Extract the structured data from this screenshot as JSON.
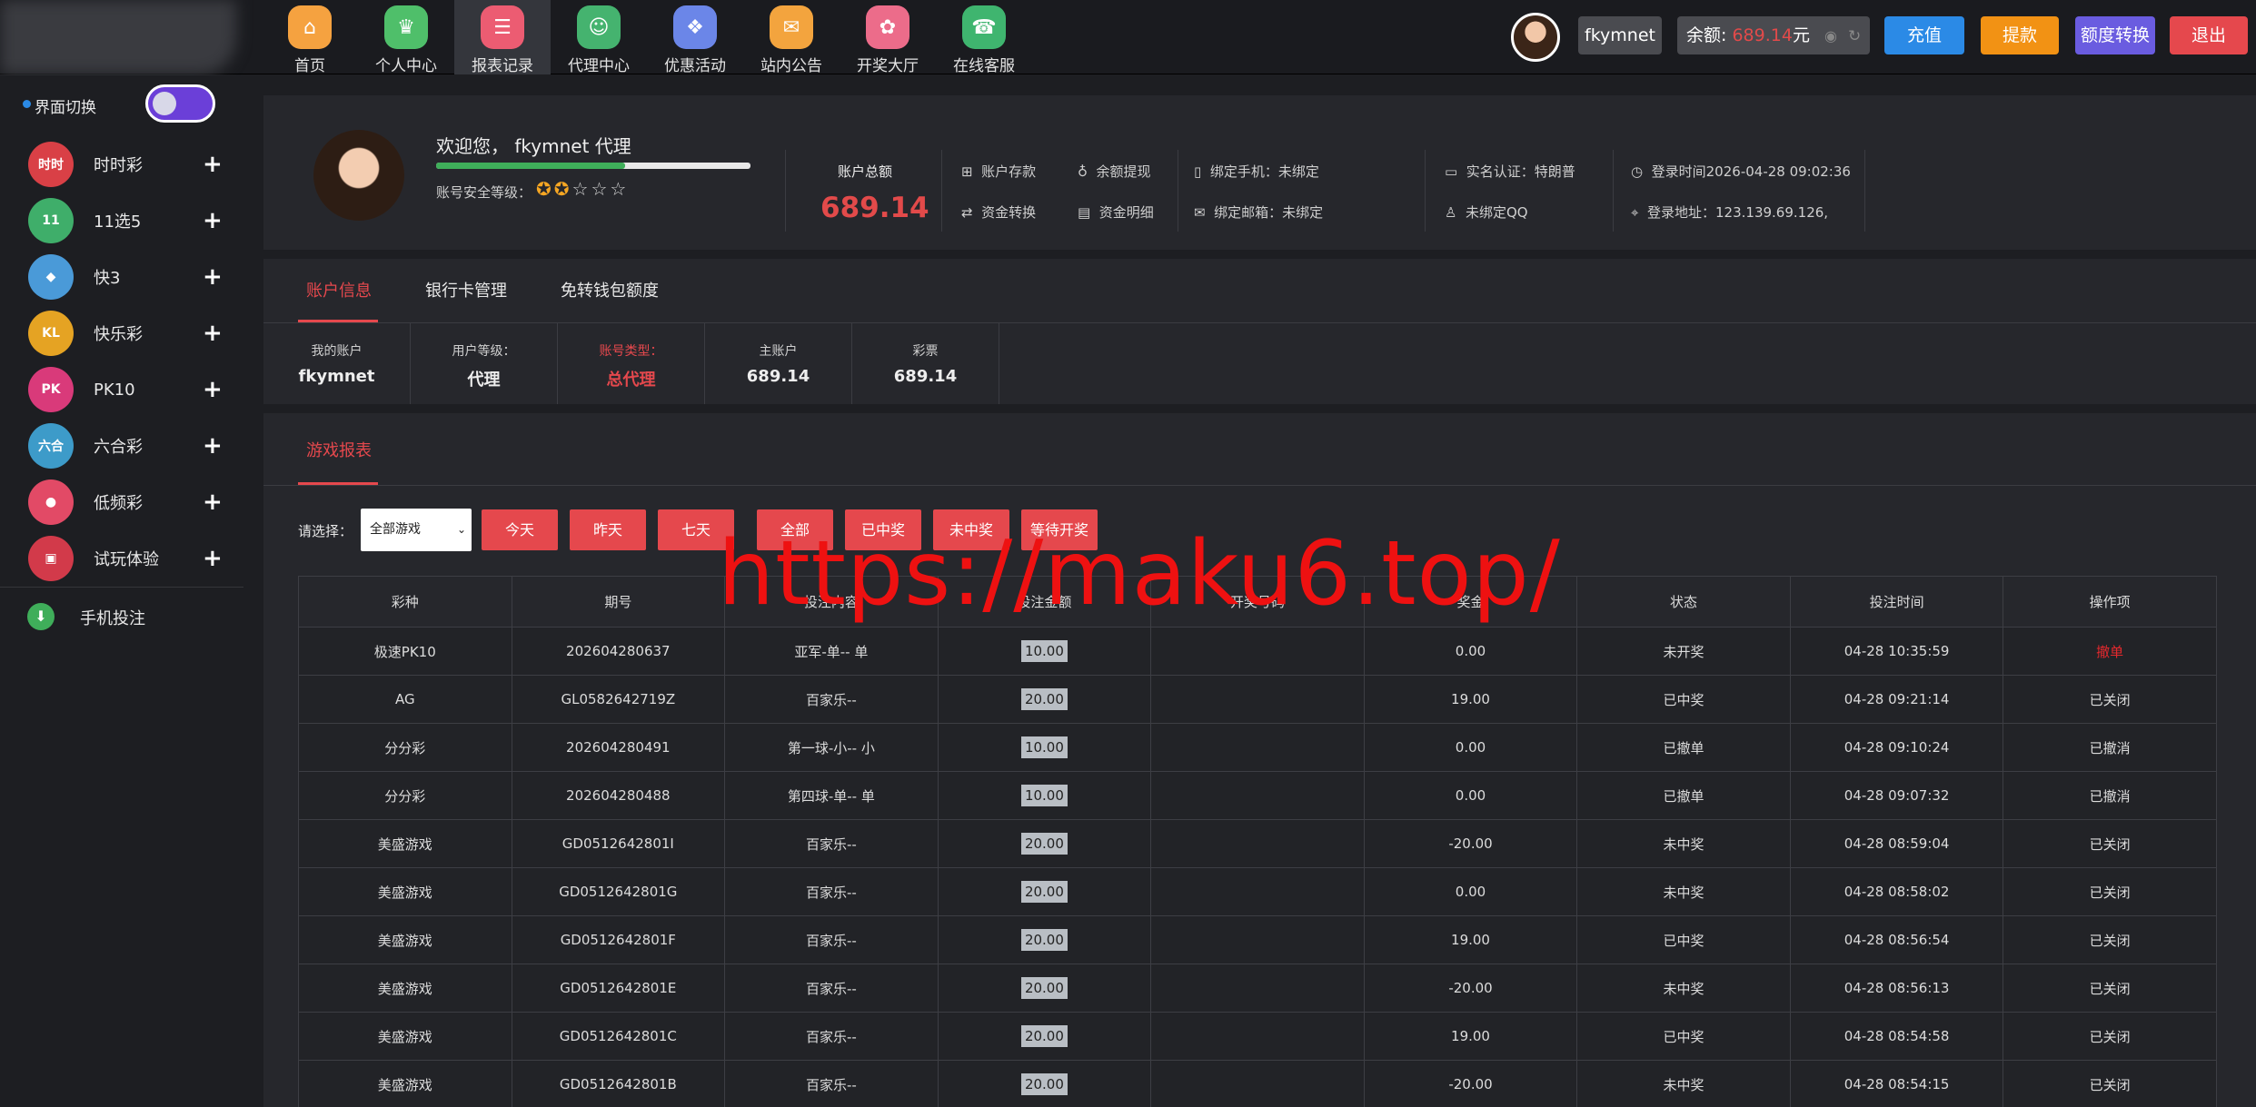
{
  "nav": [
    {
      "label": "首页",
      "color": "#f5a240",
      "icon": "home-icon",
      "glyph": "⌂"
    },
    {
      "label": "个人中心",
      "color": "#4fbf6a",
      "icon": "crown-icon",
      "glyph": "♛"
    },
    {
      "label": "报表记录",
      "color": "#ec5c72",
      "icon": "report-icon",
      "glyph": "☰"
    },
    {
      "label": "代理中心",
      "color": "#45b36f",
      "icon": "agent-icon",
      "glyph": "☺"
    },
    {
      "label": "优惠活动",
      "color": "#6b86e8",
      "icon": "gift-icon",
      "glyph": "❖"
    },
    {
      "label": "站内公告",
      "color": "#f3a43e",
      "icon": "mail-icon",
      "glyph": "✉"
    },
    {
      "label": "开奖大厅",
      "color": "#ec6c8a",
      "icon": "grid-icon",
      "glyph": "✿"
    },
    {
      "label": "在线客服",
      "color": "#3fb56f",
      "icon": "service-icon",
      "glyph": "☎"
    }
  ],
  "header": {
    "username": "fkymnet",
    "balance_label": "余额:",
    "balance_amount": "689.14",
    "balance_unit": "元",
    "buttons": [
      {
        "label": "充值",
        "color": "#2b8ae6"
      },
      {
        "label": "提款",
        "color": "#f29214"
      },
      {
        "label": "额度转换",
        "color": "#6a5ce0"
      },
      {
        "label": "退出",
        "color": "#e5484d"
      }
    ]
  },
  "sidebar": {
    "switch_label": "界面切换",
    "items": [
      {
        "label": "时时彩",
        "icon": "ssc-icon",
        "glyph": "时时",
        "color": "#d94046"
      },
      {
        "label": "11选5",
        "icon": "11x5-icon",
        "glyph": "11",
        "color": "#3fae6a"
      },
      {
        "label": "快3",
        "icon": "k3-icon",
        "glyph": "◆",
        "color": "#4a9ad8"
      },
      {
        "label": "快乐彩",
        "icon": "klc-icon",
        "glyph": "KL",
        "color": "#e5a323"
      },
      {
        "label": "PK10",
        "icon": "pk10-icon",
        "glyph": "PK",
        "color": "#d93a7a"
      },
      {
        "label": "六合彩",
        "icon": "lhc-icon",
        "glyph": "六合",
        "color": "#3d9bc9"
      },
      {
        "label": "低频彩",
        "icon": "dpc-icon",
        "glyph": "●",
        "color": "#e24a66"
      },
      {
        "label": "试玩体验",
        "icon": "gamepad-icon",
        "glyph": "▣",
        "color": "#d23a4a"
      }
    ],
    "mobile_label": "手机投注"
  },
  "profile": {
    "welcome": "欢迎您，  fkymnet 代理",
    "security_label": "账号安全等级：",
    "stars_filled": 2,
    "stars_total": 5,
    "security_level": 0.6,
    "total_label": "账户总额",
    "total_value": "689.14",
    "links": [
      "账户存款",
      "余额提现",
      "资金转换",
      "资金明细"
    ],
    "bind_phone": "绑定手机：未绑定",
    "bind_email": "绑定邮箱：未绑定",
    "realname": "实名认证：特朗普",
    "qq": "未绑定QQ",
    "login_time": "登录时间2026-04-28 09:02:36",
    "login_addr": "登录地址：123.139.69.126,"
  },
  "account_tabs": [
    "账户信息",
    "银行卡管理",
    "免转钱包额度"
  ],
  "account_info": [
    {
      "label": "我的账户",
      "value": "fkymnet",
      "highlight": false
    },
    {
      "label": "用户等级：",
      "value": "代理",
      "highlight": false
    },
    {
      "label": "账号类型：",
      "value": "总代理",
      "highlight": true
    },
    {
      "label": "主账户",
      "value": "689.14",
      "highlight": false
    },
    {
      "label": "彩票",
      "value": "689.14",
      "highlight": false
    }
  ],
  "report": {
    "tab": "游戏报表",
    "select_label": "请选择：",
    "select_value": "全部游戏",
    "date_buttons": [
      "今天",
      "昨天",
      "七天"
    ],
    "status_buttons": [
      "全部",
      "已中奖",
      "未中奖",
      "等待开奖"
    ],
    "columns": [
      "彩种",
      "期号",
      "投注内容",
      "投注金额",
      "开奖号码",
      "奖金",
      "状态",
      "投注时间",
      "操作项"
    ],
    "rows": [
      [
        "极速PK10",
        "202604280637",
        "亚军-单-- 单",
        "10.00",
        "",
        "0.00",
        "未开奖",
        "04-28 10:35:59",
        "撤单"
      ],
      [
        "AG",
        "GL0582642719Z",
        "百家乐--",
        "20.00",
        "",
        "19.00",
        "已中奖",
        "04-28 09:21:14",
        "已关闭"
      ],
      [
        "分分彩",
        "202604280491",
        "第一球-小-- 小",
        "10.00",
        "",
        "0.00",
        "已撤单",
        "04-28 09:10:24",
        "已撤消"
      ],
      [
        "分分彩",
        "202604280488",
        "第四球-单-- 单",
        "10.00",
        "",
        "0.00",
        "已撤单",
        "04-28 09:07:32",
        "已撤消"
      ],
      [
        "美盛游戏",
        "GD0512642801I",
        "百家乐--",
        "20.00",
        "",
        "-20.00",
        "未中奖",
        "04-28 08:59:04",
        "已关闭"
      ],
      [
        "美盛游戏",
        "GD0512642801G",
        "百家乐--",
        "20.00",
        "",
        "0.00",
        "未中奖",
        "04-28 08:58:02",
        "已关闭"
      ],
      [
        "美盛游戏",
        "GD0512642801F",
        "百家乐--",
        "20.00",
        "",
        "19.00",
        "已中奖",
        "04-28 08:56:54",
        "已关闭"
      ],
      [
        "美盛游戏",
        "GD0512642801E",
        "百家乐--",
        "20.00",
        "",
        "-20.00",
        "未中奖",
        "04-28 08:56:13",
        "已关闭"
      ],
      [
        "美盛游戏",
        "GD0512642801C",
        "百家乐--",
        "20.00",
        "",
        "19.00",
        "已中奖",
        "04-28 08:54:58",
        "已关闭"
      ],
      [
        "美盛游戏",
        "GD0512642801B",
        "百家乐--",
        "20.00",
        "",
        "-20.00",
        "未中奖",
        "04-28 08:54:15",
        "已关闭"
      ]
    ]
  },
  "watermark": "https://maku6.top/"
}
